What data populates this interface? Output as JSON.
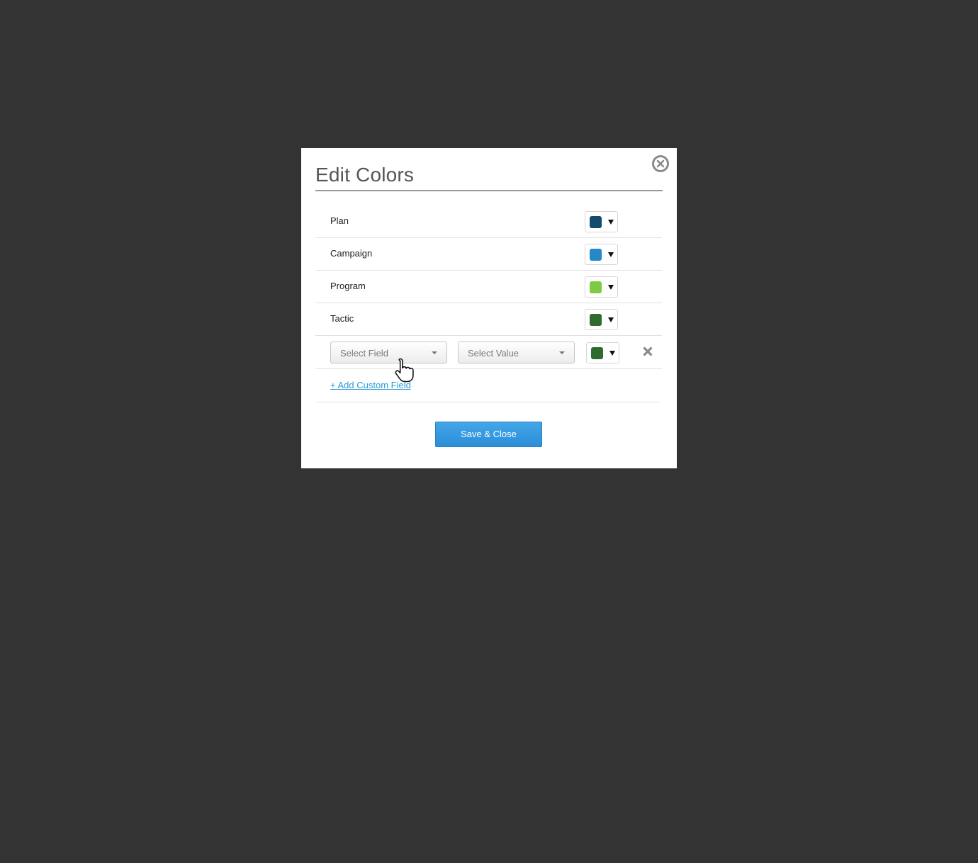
{
  "dialog": {
    "title": "Edit Colors",
    "rows": [
      {
        "label": "Plan",
        "color": "#124b6b"
      },
      {
        "label": "Campaign",
        "color": "#2589c8"
      },
      {
        "label": "Program",
        "color": "#7dcb43"
      },
      {
        "label": "Tactic",
        "color": "#2d6b2f"
      }
    ],
    "custom_row": {
      "field_placeholder": "Select Field",
      "value_placeholder": "Select Value",
      "color": "#2d6b2f"
    },
    "add_link": "+ Add Custom Field",
    "save_label": "Save & Close"
  },
  "icons": {
    "close": "close-circle-icon",
    "remove": "x-icon",
    "caret": "caret-down-icon",
    "cursor": "hand-pointer-icon"
  },
  "colors": {
    "overlay": "#333333",
    "accent": "#2b9bd8",
    "button": "#3498dc"
  }
}
